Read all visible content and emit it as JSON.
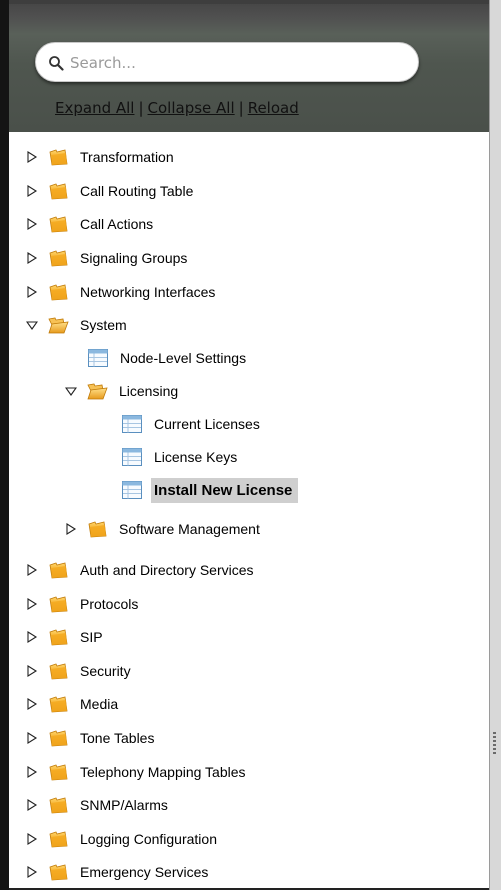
{
  "search": {
    "placeholder": "Search..."
  },
  "links": {
    "expand_all": "Expand All",
    "collapse_all": "Collapse All",
    "reload": "Reload",
    "separator": "|"
  },
  "tree": {
    "transformation": "Transformation",
    "call_routing_table": "Call Routing Table",
    "call_actions": "Call Actions",
    "signaling_groups": "Signaling Groups",
    "networking_interfaces": "Networking Interfaces",
    "system": "System",
    "node_level_settings": "Node-Level Settings",
    "licensing": "Licensing",
    "current_licenses": "Current Licenses",
    "license_keys": "License Keys",
    "install_new_license": "Install New License",
    "software_management": "Software Management",
    "auth_directory_services": "Auth and Directory Services",
    "protocols": "Protocols",
    "sip": "SIP",
    "security": "Security",
    "media": "Media",
    "tone_tables": "Tone Tables",
    "telephony_mapping_tables": "Telephony Mapping Tables",
    "snmp_alarms": "SNMP/Alarms",
    "logging_configuration": "Logging Configuration",
    "emergency_services": "Emergency Services"
  },
  "colors": {
    "folder": "#f0a824",
    "selected_bg": "#cfcfcf",
    "panel_bg": "#4f564f"
  },
  "icons": {
    "collapsed": "triangle-right-icon",
    "expanded": "triangle-down-icon",
    "folder": "folder-icon",
    "open_folder": "folder-open-icon",
    "page": "table-page-icon",
    "search": "search-icon"
  }
}
